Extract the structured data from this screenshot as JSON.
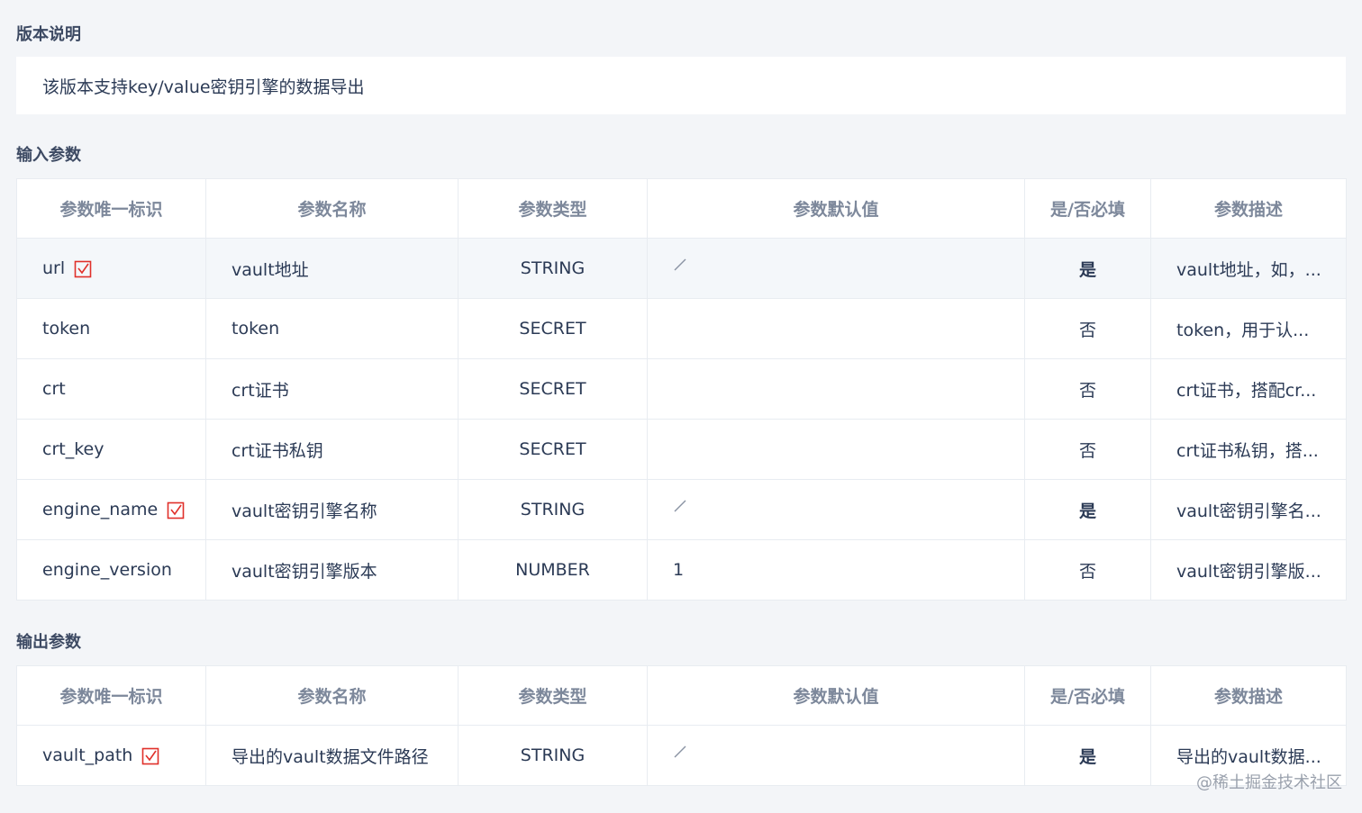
{
  "version_section": {
    "title": "版本说明",
    "description": "该版本支持key/value密钥引擎的数据导出"
  },
  "input_section": {
    "title": "输入参数",
    "headers": [
      "参数唯一标识",
      "参数名称",
      "参数类型",
      "参数默认值",
      "是/否必填",
      "参数描述"
    ],
    "rows": [
      {
        "id": "url",
        "required_icon": true,
        "name": "vault地址",
        "type": "STRING",
        "default": "",
        "default_slash": true,
        "required": "是",
        "desc": "vault地址，如，..."
      },
      {
        "id": "token",
        "required_icon": false,
        "name": "token",
        "type": "SECRET",
        "default": "",
        "default_slash": false,
        "required": "否",
        "desc": "token，用于认..."
      },
      {
        "id": "crt",
        "required_icon": false,
        "name": "crt证书",
        "type": "SECRET",
        "default": "",
        "default_slash": false,
        "required": "否",
        "desc": "crt证书，搭配cr..."
      },
      {
        "id": "crt_key",
        "required_icon": false,
        "name": "crt证书私钥",
        "type": "SECRET",
        "default": "",
        "default_slash": false,
        "required": "否",
        "desc": "crt证书私钥，搭..."
      },
      {
        "id": "engine_name",
        "required_icon": true,
        "name": "vault密钥引擎名称",
        "type": "STRING",
        "default": "",
        "default_slash": true,
        "required": "是",
        "desc": "vault密钥引擎名..."
      },
      {
        "id": "engine_version",
        "required_icon": false,
        "name": "vault密钥引擎版本",
        "type": "NUMBER",
        "default": "1",
        "default_slash": false,
        "required": "否",
        "desc": "vault密钥引擎版..."
      }
    ]
  },
  "output_section": {
    "title": "输出参数",
    "headers": [
      "参数唯一标识",
      "参数名称",
      "参数类型",
      "参数默认值",
      "是/否必填",
      "参数描述"
    ],
    "rows": [
      {
        "id": "vault_path",
        "required_icon": true,
        "name": "导出的vault数据文件路径",
        "type": "STRING",
        "default": "",
        "default_slash": true,
        "required": "是",
        "desc": "导出的vault数据..."
      }
    ]
  },
  "watermark": "@稀土掘金技术社区",
  "colors": {
    "required_red": "#e0302a",
    "background": "#f3f5f8",
    "header_text": "#7d889b"
  },
  "icons": {
    "required_marker": "required-check-icon",
    "default_placeholder": "slash-icon"
  }
}
